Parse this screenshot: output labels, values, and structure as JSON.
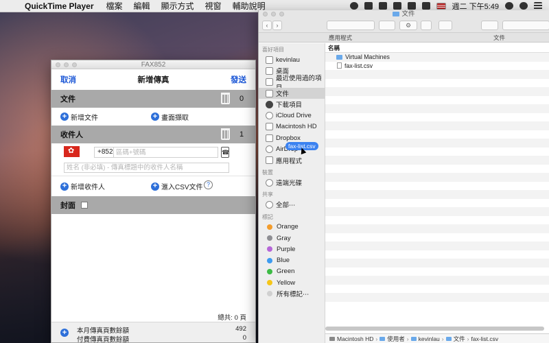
{
  "menubar": {
    "app_name": "QuickTime Player",
    "menus": [
      "檔案",
      "編輯",
      "顯示方式",
      "視窗",
      "輔助說明"
    ],
    "clock": "週二 下午5:49"
  },
  "fax": {
    "window_title": "FAX852",
    "cancel": "取消",
    "title": "新增傳真",
    "send": "發送",
    "documents": {
      "header": "文件",
      "count": "0",
      "add_doc": "新增文件",
      "scan": "畫面擷取"
    },
    "recipients": {
      "header": "收件人",
      "count": "1",
      "prefix": "+852",
      "phone_placeholder": "區碼+號碼",
      "name_placeholder": "姓名 (非必填) - 傳真標題中的收件人名稱",
      "add_recipient": "新增收件人",
      "import_csv": "滙入CSV文件",
      "help": "?"
    },
    "cover": {
      "header": "封面"
    },
    "total": "總共: 0 頁",
    "footer": {
      "monthly_label": "本月傳真頁數餘額",
      "monthly_value": "492",
      "paid_label": "付費傳真頁數餘額",
      "paid_value": "0"
    }
  },
  "finder": {
    "title": "文件",
    "tabs": [
      "應用程式",
      "文件"
    ],
    "sidebar": {
      "favorites_head": "喜好項目",
      "favorites": [
        "kevinlau",
        "桌面",
        "最近使用過的項目",
        "文件",
        "下載項目",
        "iCloud Drive",
        "Macintosh HD",
        "Dropbox",
        "AirDrop",
        "應用程式"
      ],
      "devices_head": "裝置",
      "devices": [
        "遠端光碟"
      ],
      "shared_head": "共享",
      "shared": [
        "全部⋯"
      ],
      "tags_head": "標記",
      "tags": [
        {
          "name": "Orange",
          "color": "#f39c2c"
        },
        {
          "name": "Gray",
          "color": "#8e8e93"
        },
        {
          "name": "Purple",
          "color": "#b667d8"
        },
        {
          "name": "Blue",
          "color": "#3e9bf0"
        },
        {
          "name": "Green",
          "color": "#3dbb45"
        },
        {
          "name": "Yellow",
          "color": "#f5c518"
        },
        {
          "name": "所有標記⋯",
          "color": "#d0d0d0"
        }
      ]
    },
    "drag_label": "fax-list.csv",
    "column_name": "名稱",
    "files": [
      {
        "name": "Virtual Machines",
        "kind": "folder"
      },
      {
        "name": "fax-list.csv",
        "kind": "doc"
      }
    ],
    "path": [
      "Macintosh HD",
      "使用者",
      "kevinlau",
      "文件",
      "fax-list.csv"
    ]
  }
}
